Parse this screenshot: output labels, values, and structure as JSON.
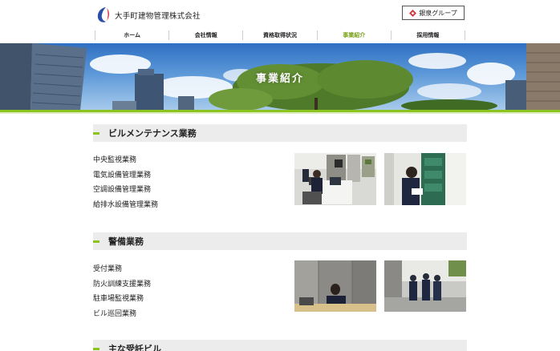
{
  "header": {
    "company_name": "大手町建物管理株式会社",
    "group_button_label": "銀泉グループ"
  },
  "nav": {
    "items": [
      {
        "label": "ホーム"
      },
      {
        "label": "会社情報"
      },
      {
        "label": "資格取得状況"
      },
      {
        "label": "事業紹介"
      },
      {
        "label": "採用情報"
      }
    ],
    "active_index": 3
  },
  "hero": {
    "title": "事業紹介"
  },
  "sections": [
    {
      "title": "ビルメンテナンス業務",
      "items": [
        "中央監視業務",
        "電気設備管理業務",
        "空調設備管理業務",
        "給排水設備管理業務"
      ]
    },
    {
      "title": "警備業務",
      "items": [
        "受付業務",
        "防火訓練支援業務",
        "駐車場監視業務",
        "ビル巡回業務"
      ]
    },
    {
      "title": "主な受託ビル"
    }
  ],
  "colors": {
    "accent_green": "#8cc41f",
    "active_nav": "#7ba21b",
    "section_bg": "#ececec"
  }
}
